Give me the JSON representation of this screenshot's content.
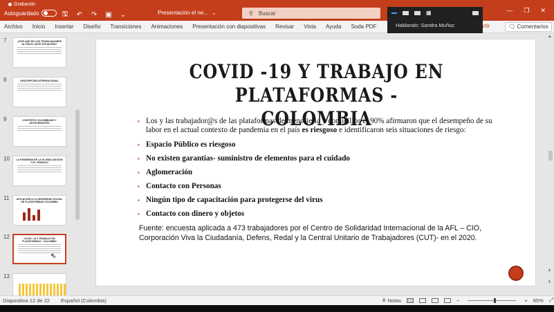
{
  "titlebar": {
    "recording_label": "Grabando",
    "autosave_label": "Autoguardado",
    "autosave_state": "off",
    "filename": "Presentación el ne...",
    "search_placeholder": "Buscar",
    "accent_color": "#c43e1c"
  },
  "floatbar": {
    "speaking_label": "Hablando: Sandra Muñoz"
  },
  "ribbon": {
    "tabs": [
      "Archivo",
      "Inicio",
      "Insertar",
      "Diseño",
      "Transiciones",
      "Animaciones",
      "Presentación con diapositivas",
      "Revisar",
      "Vista",
      "Ayuda",
      "Soda PDF"
    ],
    "share_label": "partir",
    "comments_label": "Comentarios"
  },
  "thumbnails": [
    {
      "num": "7",
      "title": "¿POR QUÉ EN LOS TRABAJADORES AL DÍA EL ANTE SITUACIÓN?"
    },
    {
      "num": "8",
      "title": "DESCRIPCIÓN INTERNACIONAL"
    },
    {
      "num": "9",
      "title": "CONTEXTO COLOMBIANO Y ANTECEDENTES"
    },
    {
      "num": "10",
      "title": "LA PANDEMIA DE LA GLOBALIZACIÓN Y EL TRABAJO"
    },
    {
      "num": "11",
      "title": "AFILIACIÓN A LA SEGURIDAD SOCIAL DE PLATAFORMAS COLOMBIA"
    },
    {
      "num": "12",
      "title": "COVID -19 Y TRABAJO EN PLATAFORMAS - COLOMBIA"
    },
    {
      "num": "13",
      "title": ""
    }
  ],
  "active_slide": "12",
  "slide": {
    "title_line1": "COVID -19 Y TRABAJO EN PLATAFORMAS -",
    "title_line2": "COLOMBIA",
    "intro_part1": "Los y las trabajador@s de las plataformas de mensajeria y domicilios el 90% afirmaron que el desempeño de su labor en el actual contexto de pandemia en el país ",
    "intro_bold": "es riesgoso",
    "intro_part2": " e identificaron seis situaciones de riesgo:",
    "bullets": [
      "Espacio Público es riesgoso",
      "No existen garantías- suministro de elementos para el cuidado",
      "Aglomeración",
      "Contacto con Personas",
      "Ningún tipo de capacitación para protegerse del virus",
      "Contacto con dinero y objetos"
    ],
    "source": "Fuente: encuesta aplicada a 473 trabajadores por el Centro de Solidaridad Internacional de la AFL – CIO, Corporación Viva la Ciudadanía, Defens, Redal y la Central Unitario de Trabajadores (CUT)- en el 2020."
  },
  "statusbar": {
    "slide_info": "Diapositiva 12 de 22",
    "language": "Español (Colombia)",
    "notes_label": "Notas",
    "zoom": "85%"
  }
}
